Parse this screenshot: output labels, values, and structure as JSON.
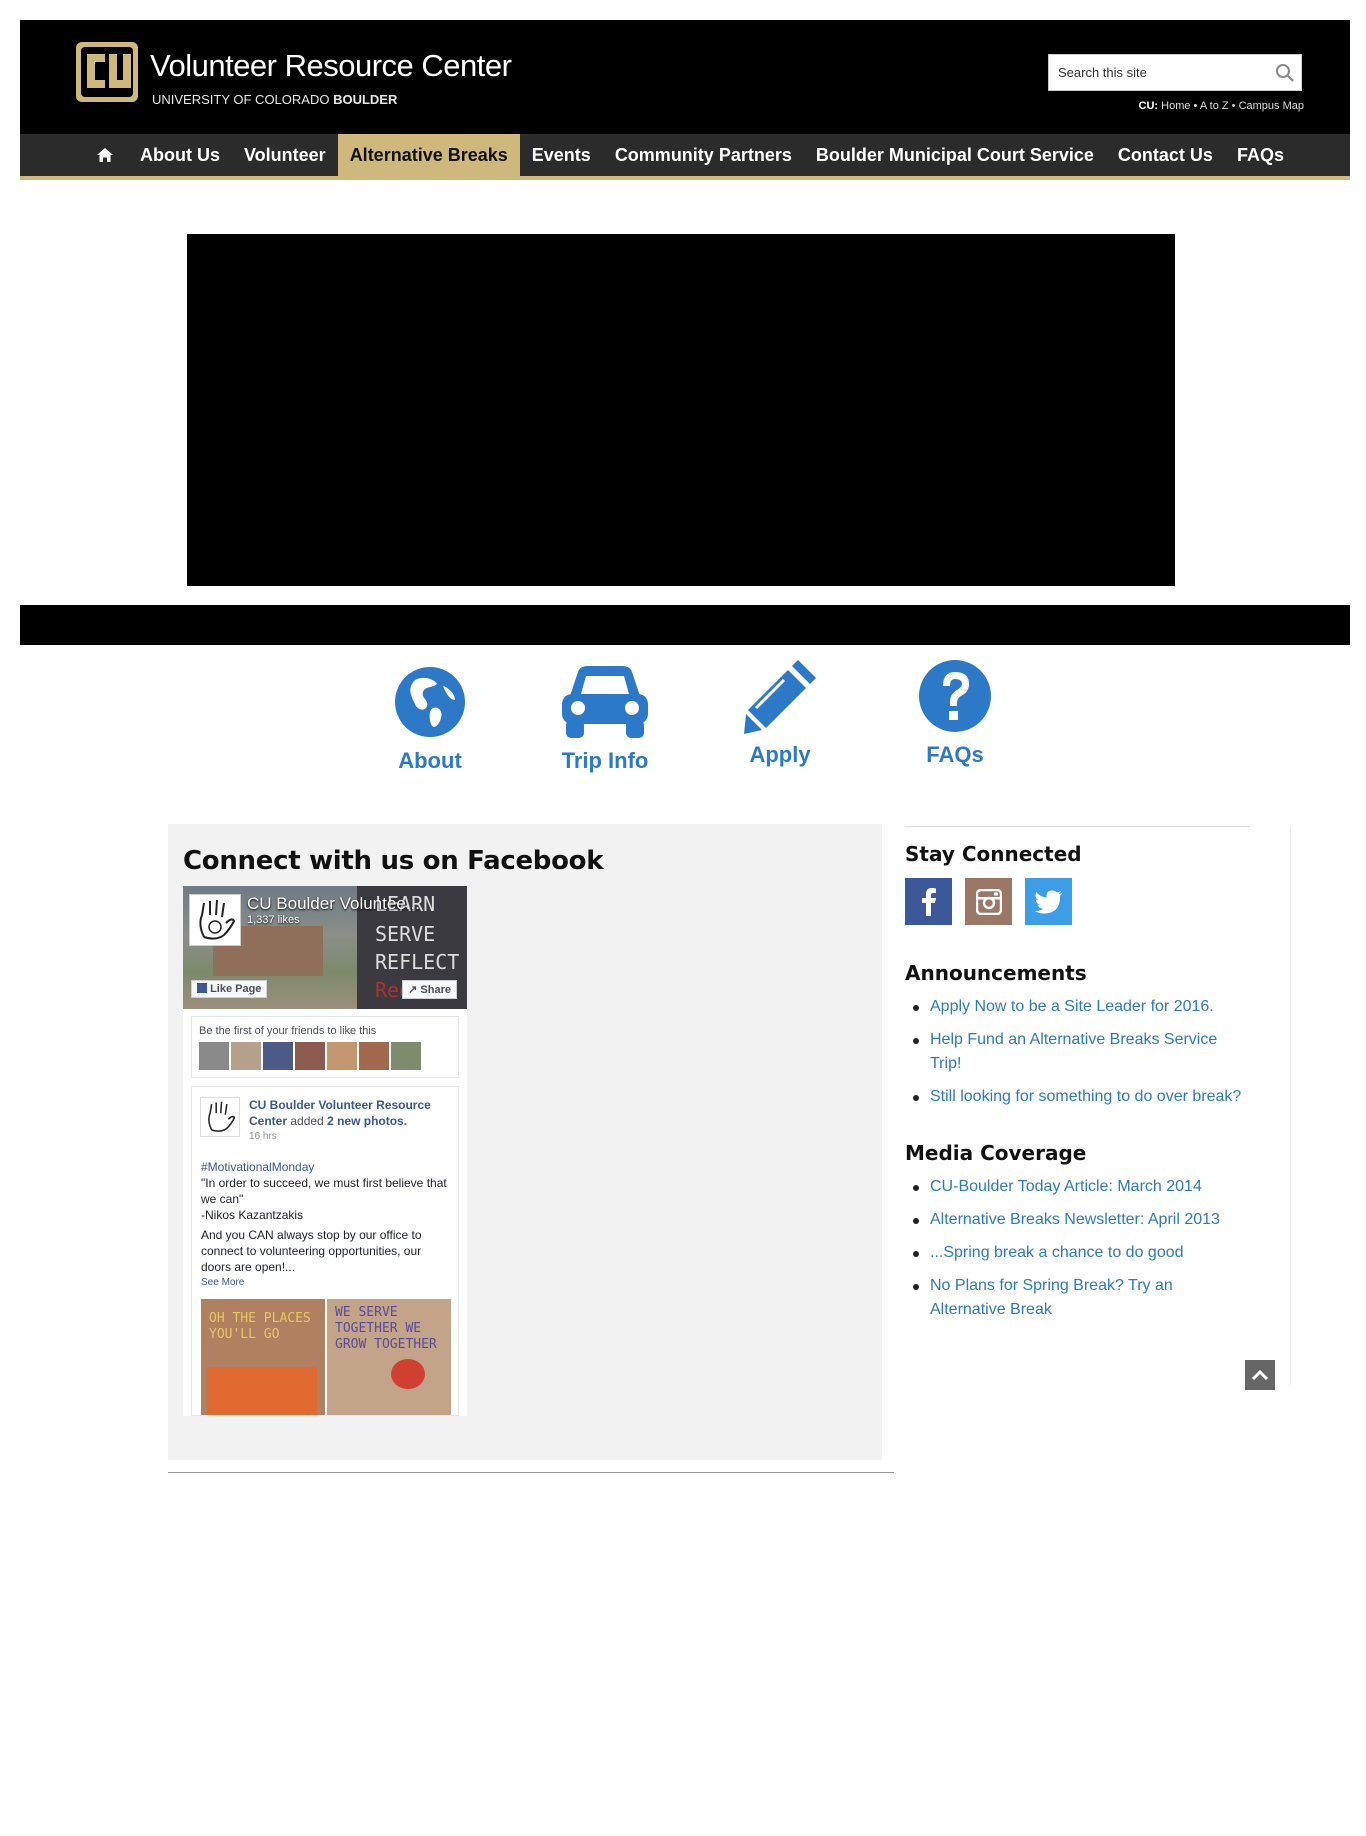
{
  "header": {
    "title": "Volunteer Resource Center",
    "subtitle_prefix": "UNIVERSITY OF COLORADO ",
    "subtitle_bold": "BOULDER",
    "logo_text": "CU",
    "search_placeholder": "Search this site",
    "util_prefix": "CU:",
    "util_home": "Home",
    "util_az": "A to Z",
    "util_map": "Campus Map",
    "util_sep": " • "
  },
  "nav": {
    "home_icon": "home-icon",
    "items": [
      {
        "label": "About Us"
      },
      {
        "label": "Volunteer"
      },
      {
        "label": "Alternative Breaks",
        "active": true
      },
      {
        "label": "Events"
      },
      {
        "label": "Community Partners"
      },
      {
        "label": "Boulder Municipal Court Service"
      },
      {
        "label": "Contact Us"
      },
      {
        "label": "FAQs"
      }
    ]
  },
  "quick_links": [
    {
      "label": "About",
      "icon": "globe-icon"
    },
    {
      "label": "Trip Info",
      "icon": "car-icon"
    },
    {
      "label": "Apply",
      "icon": "pencil-icon"
    },
    {
      "label": "FAQs",
      "icon": "question-icon"
    }
  ],
  "facebook": {
    "heading": "Connect with us on Facebook",
    "page_name": "CU Boulder Voluntee...",
    "likes": "1,337 likes",
    "like_btn": "Like Page",
    "share_btn": "Share",
    "cover_sign": [
      "LEARN",
      "SERVE",
      "REFLECT",
      "Reduce"
    ],
    "friends_text": "Be the first of your friends to like this",
    "post_author": "CU Boulder Volunteer Resource Center",
    "post_action": " added ",
    "post_count": "2 new photos.",
    "post_time": "16 hrs",
    "post_tag": "#MotivationalMonday",
    "post_quote": "\"In order to succeed, we must first believe that we can\"",
    "post_attrib": "-Nikos Kazantzakis",
    "post_body": "And you CAN always stop by our office to connect to volunteering opportunities, our doors are open!...",
    "post_more": "See More",
    "photo1_text": "OH THE PLACES YOU'LL GO",
    "photo2_text": "WE SERVE TOGETHER WE GROW TOGETHER"
  },
  "sidebar": {
    "stay_connected": "Stay Connected",
    "social": [
      {
        "name": "facebook",
        "icon": "facebook-icon",
        "color": "#3b5998"
      },
      {
        "name": "instagram",
        "icon": "instagram-icon",
        "color": "#9b7766"
      },
      {
        "name": "twitter",
        "icon": "twitter-icon",
        "color": "#3d9ee8"
      }
    ],
    "announcements_title": "Announcements",
    "announcements": [
      "Apply Now to be a Site Leader for 2016.",
      "Help Fund an Alternative Breaks Service Trip!",
      "Still looking for something to do over break?"
    ],
    "media_title": "Media Coverage",
    "media": [
      "CU-Boulder Today Article: March 2014",
      "Alternative Breaks Newsletter: April 2013",
      "...Spring break a chance to do good",
      "No Plans for Spring Break? Try an Alternative Break"
    ]
  },
  "colors": {
    "gold": "#cfb87c",
    "link_blue": "#2c7ac7",
    "nav_bg": "#2b2b2b"
  }
}
